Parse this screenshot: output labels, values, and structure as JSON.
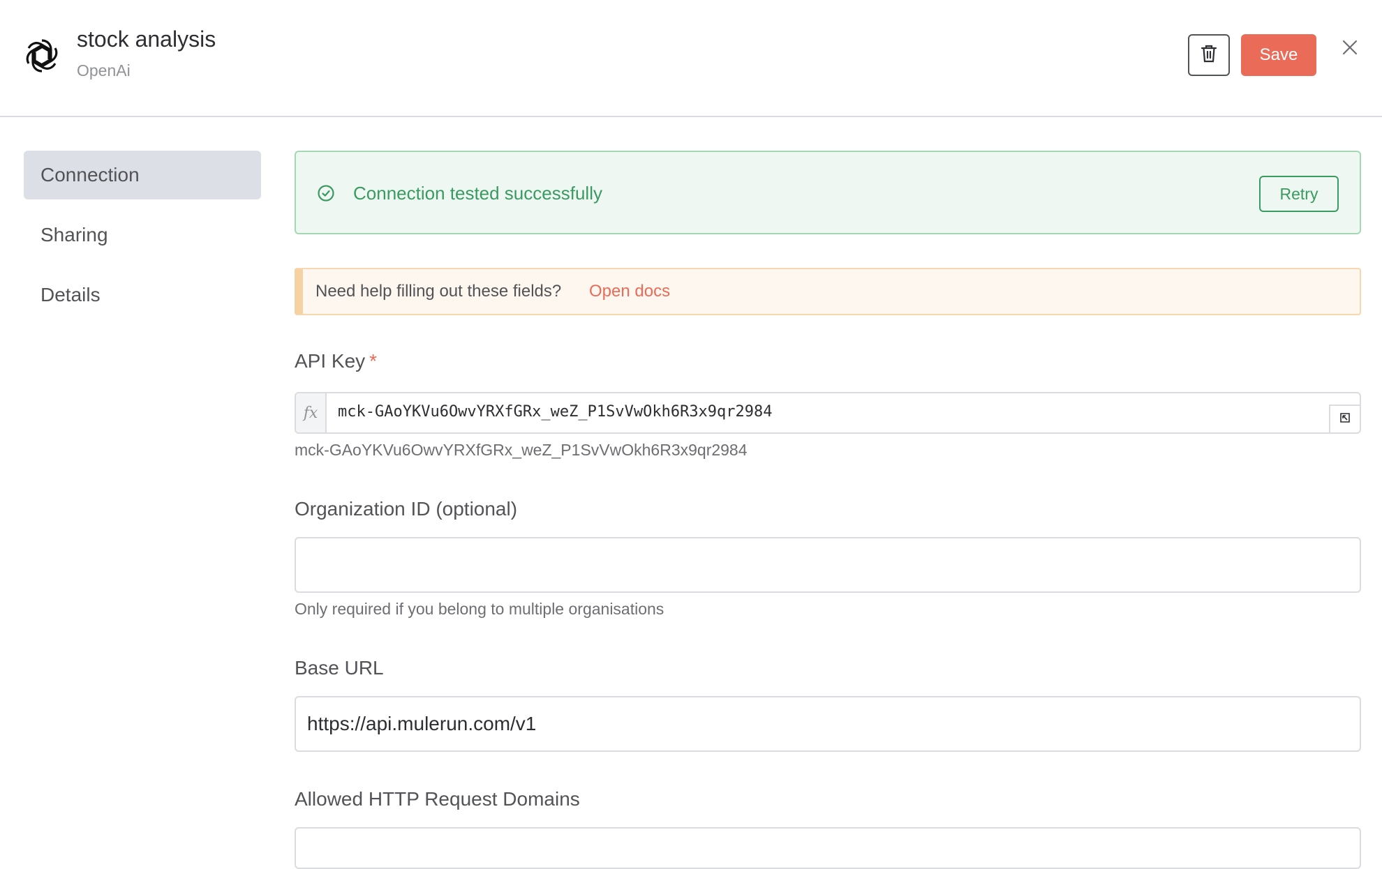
{
  "header": {
    "title": "stock analysis",
    "subtitle": "OpenAi",
    "logo_icon": "openai-logo",
    "save_label": "Save",
    "delete_icon": "trash-icon",
    "close_icon": "close-icon"
  },
  "sidebar": {
    "items": [
      {
        "label": "Connection",
        "active": true
      },
      {
        "label": "Sharing",
        "active": false
      },
      {
        "label": "Details",
        "active": false
      }
    ]
  },
  "status": {
    "message": "Connection tested successfully",
    "retry_label": "Retry",
    "color": "#3a9a61"
  },
  "help": {
    "text": "Need help filling out these fields?",
    "link_label": "Open docs"
  },
  "form": {
    "api_key": {
      "label": "API Key",
      "required_mark": "*",
      "fx_label": "fx",
      "value": "mck-GAoYKVu6OwvYRXfGRx_weZ_P1SvVwOkh6R3x9qr2984",
      "preview": "mck-GAoYKVu6OwvYRXfGRx_weZ_P1SvVwOkh6R3x9qr2984"
    },
    "organization_id": {
      "label": "Organization ID (optional)",
      "value": "",
      "hint": "Only required if you belong to multiple organisations"
    },
    "base_url": {
      "label": "Base URL",
      "value": "https://api.mulerun.com/v1"
    },
    "allowed_domains": {
      "label": "Allowed HTTP Request Domains"
    }
  },
  "colors": {
    "accent": "#ea6c58",
    "success": "#3a9a61",
    "warning_border": "#f4d2a3"
  }
}
